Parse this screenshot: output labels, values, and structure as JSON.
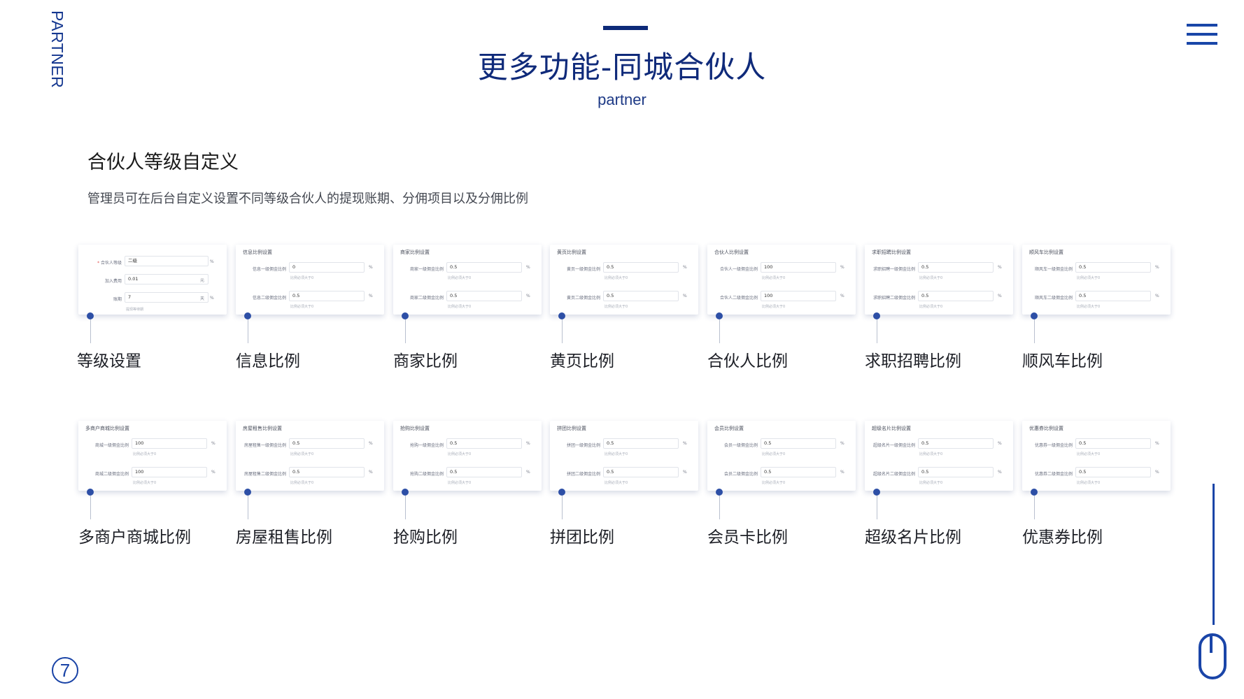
{
  "side_label": "PARTNER",
  "title": "更多功能-同城合伙人",
  "subtitle": "partner",
  "section": {
    "heading": "合伙人等级自定义",
    "description": "管理员可在后台自定义设置不同等级合伙人的提现账期、分佣项目以及分佣比例"
  },
  "level_card": {
    "label": "等级设置",
    "title": "",
    "fields": [
      {
        "label": "合伙人等级",
        "required": true,
        "value": "二级",
        "inner_unit": "",
        "unit": "%"
      },
      {
        "label": "加入费用",
        "required": false,
        "value": "0.01",
        "inner_unit": "元",
        "unit": ""
      },
      {
        "label": "账期",
        "required": false,
        "value": "7",
        "inner_unit": "天",
        "unit": "%"
      }
    ],
    "hint": "提现等待期"
  },
  "ratio_cards": [
    {
      "label": "信息比例",
      "title": "信息比例设置",
      "fields": [
        {
          "label": "信息一级佣金比例",
          "value": "0"
        },
        {
          "label": "信息二级佣金比例",
          "value": "0.5"
        }
      ]
    },
    {
      "label": "商家比例",
      "title": "商家比例设置",
      "fields": [
        {
          "label": "商家一级佣金比例",
          "value": "0.5"
        },
        {
          "label": "商家二级佣金比例",
          "value": "0.5"
        }
      ]
    },
    {
      "label": "黄页比例",
      "title": "黄页比例设置",
      "fields": [
        {
          "label": "黄页一级佣金比例",
          "value": "0.5"
        },
        {
          "label": "黄页二级佣金比例",
          "value": "0.5"
        }
      ]
    },
    {
      "label": "合伙人比例",
      "title": "合伙人比例设置",
      "fields": [
        {
          "label": "合伙人一级佣金比例",
          "value": "100"
        },
        {
          "label": "合伙人二级佣金比例",
          "value": "100"
        }
      ]
    },
    {
      "label": "求职招聘比例",
      "title": "求职招聘比例设置",
      "fields": [
        {
          "label": "求职招聘一级佣金比例",
          "value": "0.5"
        },
        {
          "label": "求职招聘二级佣金比例",
          "value": "0.5"
        }
      ]
    },
    {
      "label": "顺风车比例",
      "title": "顺风车比例设置",
      "fields": [
        {
          "label": "顺风车一级佣金比例",
          "value": "0.5"
        },
        {
          "label": "顺风车二级佣金比例",
          "value": "0.5"
        }
      ]
    },
    {
      "label": "多商户商城比例",
      "title": "多商户商城比例设置",
      "fields": [
        {
          "label": "商城一级佣金比例",
          "value": "100"
        },
        {
          "label": "商城二级佣金比例",
          "value": "100"
        }
      ]
    },
    {
      "label": "房屋租售比例",
      "title": "房屋租售比例设置",
      "fields": [
        {
          "label": "房屋租售一级佣金比例",
          "value": "0.5"
        },
        {
          "label": "房屋租售二级佣金比例",
          "value": "0.5"
        }
      ]
    },
    {
      "label": "抢购比例",
      "title": "抢购比例设置",
      "fields": [
        {
          "label": "抢购一级佣金比例",
          "value": "0.5"
        },
        {
          "label": "抢购二级佣金比例",
          "value": "0.5"
        }
      ]
    },
    {
      "label": "拼团比例",
      "title": "拼团比例设置",
      "fields": [
        {
          "label": "拼团一级佣金比例",
          "value": "0.5"
        },
        {
          "label": "拼团二级佣金比例",
          "value": "0.5"
        }
      ]
    },
    {
      "label": "会员卡比例",
      "title": "会员比例设置",
      "fields": [
        {
          "label": "会员一级佣金比例",
          "value": "0.5"
        },
        {
          "label": "会员二级佣金比例",
          "value": "0.5"
        }
      ]
    },
    {
      "label": "超级名片比例",
      "title": "超级名片比例设置",
      "fields": [
        {
          "label": "超级名片一级佣金比例",
          "value": "0.5"
        },
        {
          "label": "超级名片二级佣金比例",
          "value": "0.5"
        }
      ]
    },
    {
      "label": "优惠券比例",
      "title": "优惠券比例设置",
      "fields": [
        {
          "label": "优惠券一级佣金比例",
          "value": "0.5"
        },
        {
          "label": "优惠券二级佣金比例",
          "value": "0.5"
        }
      ]
    }
  ],
  "field_unit": "%",
  "field_hint": "比例必须大于0",
  "page_number": "7",
  "colors": {
    "brand": "#13368f",
    "accent": "#1a45a8",
    "pin": "#2d4fa6"
  }
}
